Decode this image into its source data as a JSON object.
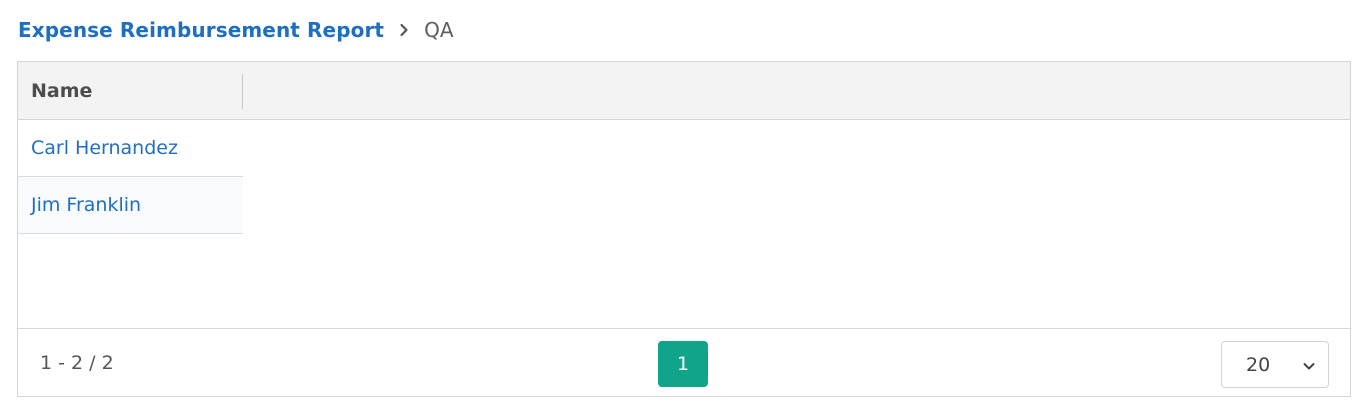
{
  "breadcrumb": {
    "parent_label": "Expense Reimbursement Report",
    "separator_icon": "chevron-right-icon",
    "current_label": "QA"
  },
  "grid": {
    "columns": [
      {
        "label": "Name"
      }
    ],
    "rows": [
      {
        "name": "Carl Hernandez"
      },
      {
        "name": "Jim Franklin"
      }
    ]
  },
  "pager": {
    "info": "1 - 2 / 2",
    "current_page": "1",
    "page_size": "20",
    "page_size_icon": "chevron-down-icon",
    "accent_color": "#10a58a"
  },
  "colors": {
    "link": "#1f6fc1",
    "header_bg": "#f3f3f3",
    "border": "#d6d6d6"
  }
}
